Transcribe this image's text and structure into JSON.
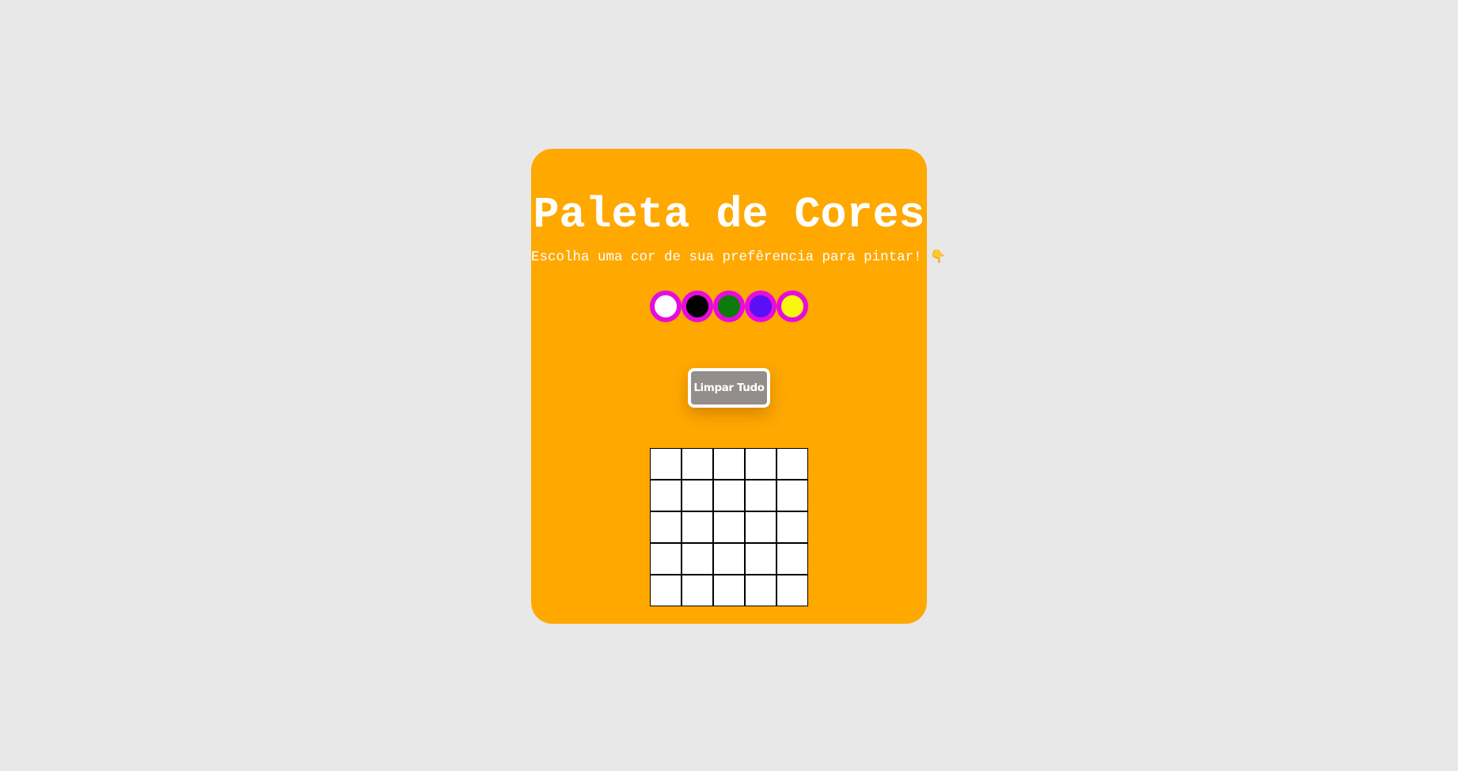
{
  "header": {
    "title": "Paleta de Cores",
    "subtitle": "Escolha uma cor de sua prefêrencia para pintar!",
    "subtitle_emoji": "👇"
  },
  "colors": {
    "page_background": "#e8e8e8",
    "card_background": "#ffa800",
    "swatch_border": "#e60cdc",
    "button_background": "#938e8b",
    "pixel_background": "#ffffff",
    "pixel_border": "#000000"
  },
  "palette": {
    "swatches": [
      {
        "color": "#ffffff"
      },
      {
        "color": "#000000"
      },
      {
        "color": "#0c7a0c"
      },
      {
        "color": "#5a10f5"
      },
      {
        "color": "#f7f70f"
      }
    ]
  },
  "controls": {
    "clear_label": "Limpar Tudo"
  },
  "board": {
    "rows": 5,
    "columns": 5
  }
}
